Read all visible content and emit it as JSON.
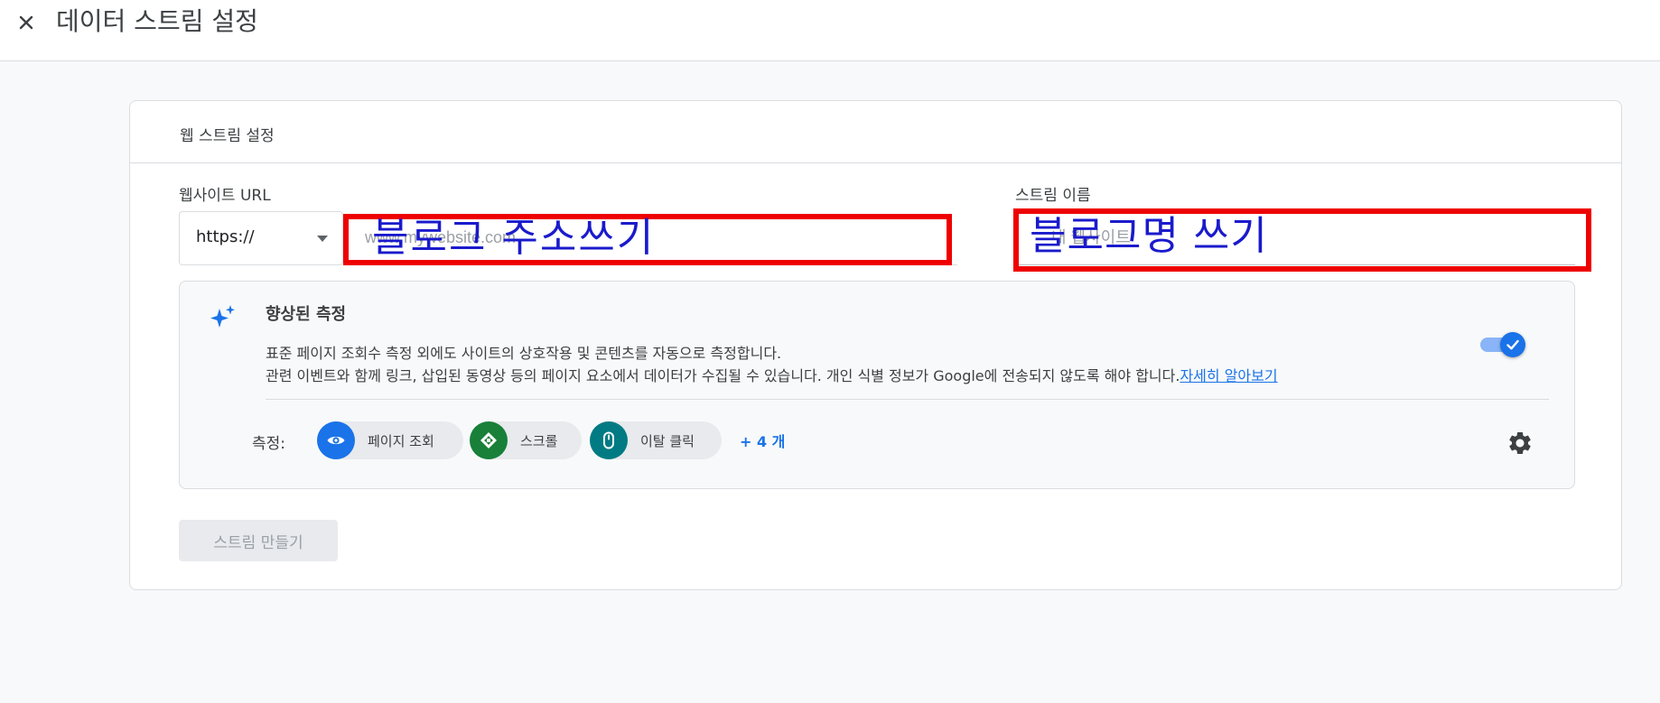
{
  "header": {
    "title": "데이터 스트림 설정"
  },
  "card": {
    "title": "웹 스트림 설정",
    "url_label": "웹사이트 URL",
    "protocol_value": "https://",
    "url_placeholder": "www.mywebsite.com",
    "name_label": "스트림 이름",
    "name_placeholder": "내 웹사이트"
  },
  "annotations": {
    "url_note": "블로그 주소쓰기",
    "name_note": "블로그명 쓰기"
  },
  "enhanced": {
    "title": "향상된 측정",
    "desc_line1": "표준 페이지 조회수 측정 외에도 사이트의 상호작용 및 콘텐츠를 자동으로 측정합니다.",
    "desc_line2": "관련 이벤트와 함께 링크, 삽입된 동영상 등의 페이지 요소에서 데이터가 수집될 수 있습니다. 개인 식별 정보가 Google에 전송되지 않도록 해야 합니다.",
    "learn_more": "자세히 알아보기",
    "toggle_on": true,
    "measure_label": "측정:",
    "chips": [
      {
        "label": "페이지 조회",
        "icon": "eye-icon",
        "color": "#1a73e8"
      },
      {
        "label": "스크롤",
        "icon": "scroll-icon",
        "color": "#188038"
      },
      {
        "label": "이탈 클릭",
        "icon": "mouse-icon",
        "color": "#007b83"
      }
    ],
    "more": "+ 4 개"
  },
  "actions": {
    "create_label": "스트림 만들기"
  },
  "colors": {
    "accent": "#1a73e8",
    "annotation_box": "#ee0000",
    "annotation_text": "#1a1acc"
  }
}
